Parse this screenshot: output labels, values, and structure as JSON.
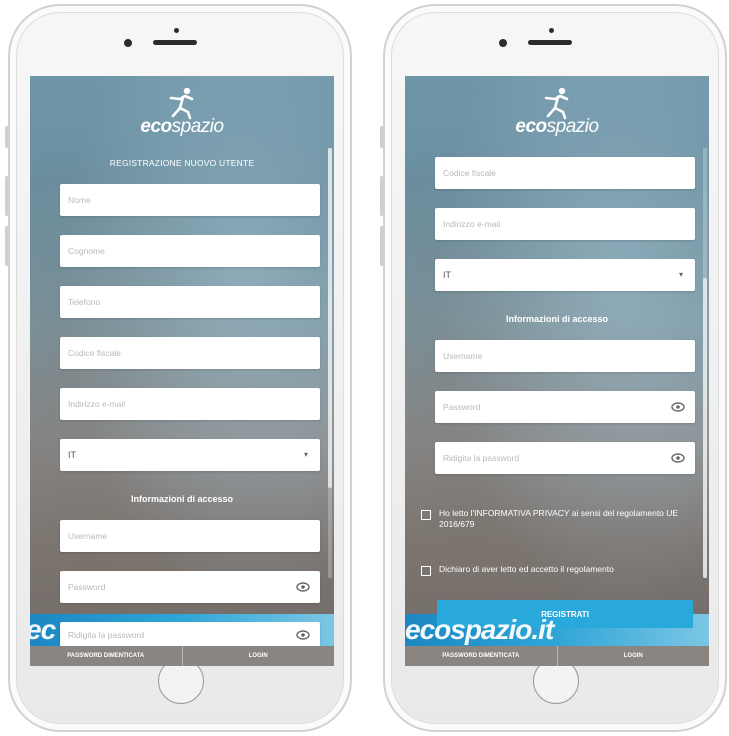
{
  "brand": {
    "logo_bold": "eco",
    "logo_rest": "spazio"
  },
  "left": {
    "title": "REGISTRAZIONE NUOVO UTENTE",
    "fields": {
      "nome": "Nome",
      "cognome": "Cognome",
      "telefono": "Telefono",
      "codice_fiscale": "Codice fiscale",
      "email": "Indirizzo e-mail",
      "country": "IT",
      "username": "Username",
      "password": "Password",
      "repeat_password": "Ridigita la password"
    },
    "section_access": "Informazioni di accesso",
    "band_text": "ec"
  },
  "right": {
    "fields": {
      "codice_fiscale": "Codice fiscale",
      "email": "Indirizzo e-mail",
      "country": "IT",
      "username": "Username",
      "password": "Password",
      "repeat_password": "Ridigita la password"
    },
    "section_access": "Informazioni di accesso",
    "privacy_text": "Ho letto l'INFORMATIVA PRIVACY ai sensi del regolamento UE 2016/679",
    "regolamento_text": "Dichiaro di aver letto ed accetto il regolamento",
    "register_button": "REGISTRATI",
    "band_text": "ecospazio.it"
  },
  "bottom_bar": {
    "forgot": "PASSWORD DIMENTICATA",
    "login": "LOGIN"
  },
  "colors": {
    "accent": "#29a9db",
    "bar": "#8a8580"
  },
  "icons": {
    "eye": "eye-icon",
    "arrow": "triangle-down-icon",
    "logo": "running-man-icon"
  }
}
